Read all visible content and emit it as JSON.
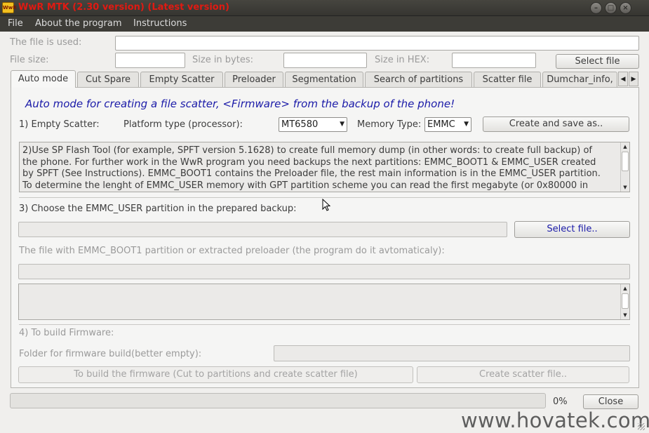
{
  "window": {
    "title": "WwR MTK (2.30 version) (Latest version)",
    "icon_text": "WwR",
    "icons": {
      "minimize": "minimize-icon",
      "maximize": "maximize-icon",
      "close": "close-icon"
    }
  },
  "menu": {
    "items": [
      "File",
      "About the program",
      "Instructions"
    ]
  },
  "file_info": {
    "file_used_label": "The file is used:",
    "file_size_label": "File size:",
    "size_bytes_label": "Size in bytes:",
    "size_hex_label": "Size in HEX:",
    "select_file_label": "Select file"
  },
  "tabs": {
    "items": [
      "Auto mode",
      "Cut Spare",
      "Empty Scatter",
      "Preloader",
      "Segmentation",
      "Search of partitions",
      "Scatter file",
      "Dumchar_info,"
    ],
    "active": "Auto mode"
  },
  "auto_mode": {
    "heading": "Auto mode for creating a file scatter, <Firmware> from the backup of the phone!",
    "step1_label": "1) Empty Scatter:",
    "platform_label": "Platform type (processor):",
    "platform_value": "MT6580",
    "memory_label": "Memory Type:",
    "memory_value": "EMMC",
    "create_save_label": "Create and save as..",
    "instructions_lines": [
      "2)Use SP Flash Tool (for example, SPFT version 5.1628) to create full memory dump (in other words: to create full backup) of",
      "the phone. For further work in the WwR program you need backups the next partitions: EMMC_BOOT1 & EMMC_USER created",
      "by SPFT (See Instructions). EMMC_BOOT1 contains the Preloader file, the rest main information is in the EMMC_USER partition.",
      "To determine the lenght of EMMC_USER memory with GPT partition scheme you can read the first megabyte (or 0x80000 in"
    ],
    "step3_label": "3) Choose the EMMC_USER partition in the prepared backup:",
    "select_file_label": "Select file..",
    "boot1_label": "The file with EMMC_BOOT1 partition or extracted preloader (the program do it avtomaticaly):",
    "step4_label": "4) To build Firmware:",
    "folder_label": "Folder for firmware build(better empty):",
    "build_label": "To build the firmware (Cut to partitions and create scatter file)",
    "create_scatter_label": "Create scatter file.."
  },
  "footer": {
    "progress_percent": 0,
    "progress_text": "0%",
    "close_label": "Close"
  },
  "watermark": "www.hovatek.com",
  "colors": {
    "title_red": "#e01a12",
    "heading_blue": "#1a1aa8",
    "select_file_blue": "#1a1aa8",
    "window_bg": "#f0efed",
    "titlebar_bg": "#3d3c37"
  }
}
